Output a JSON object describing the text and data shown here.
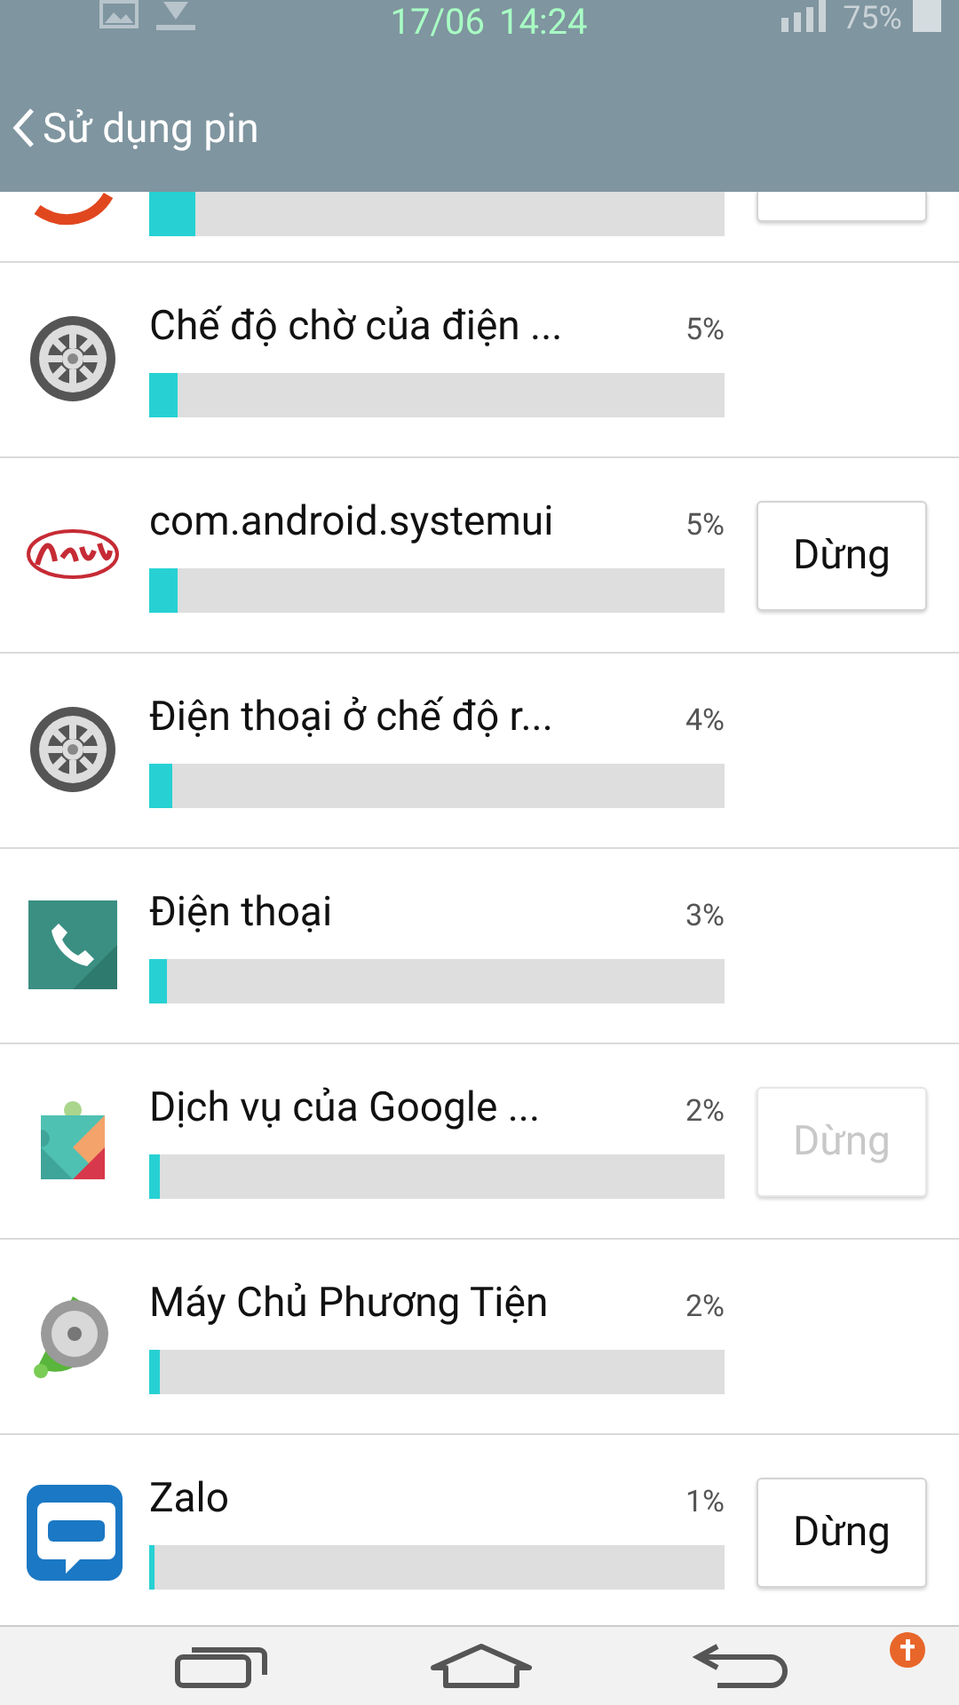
{
  "status_bar": {
    "date": "17/06",
    "time": "14:24",
    "battery": "75%"
  },
  "header": {
    "title": "Sử dụng pin"
  },
  "scrolled_row": {
    "level": 0.08
  },
  "apps": [
    {
      "kind": "gear",
      "name": "Chế độ chờ của điện ...",
      "percent": "5%",
      "level": 0.05
    },
    {
      "kind": "android",
      "name": "com.android.systemui",
      "percent": "5%",
      "level": 0.05,
      "stop": {
        "label": "Dừng",
        "disabled": false
      }
    },
    {
      "kind": "gear",
      "name": "Điện thoại ở chế độ r...",
      "percent": "4%",
      "level": 0.04
    },
    {
      "kind": "phone",
      "name": "Điện thoại",
      "percent": "3%",
      "level": 0.03
    },
    {
      "kind": "puzzle",
      "name": "Dịch vụ của Google ...",
      "percent": "2%",
      "level": 0.02,
      "stop": {
        "label": "Dừng",
        "disabled": true
      }
    },
    {
      "kind": "media",
      "name": "Máy Chủ Phương Tiện",
      "percent": "2%",
      "level": 0.02
    },
    {
      "kind": "zalo",
      "name": "Zalo",
      "percent": "1%",
      "level": 0.01,
      "stop": {
        "label": "Dừng",
        "disabled": false
      }
    }
  ]
}
